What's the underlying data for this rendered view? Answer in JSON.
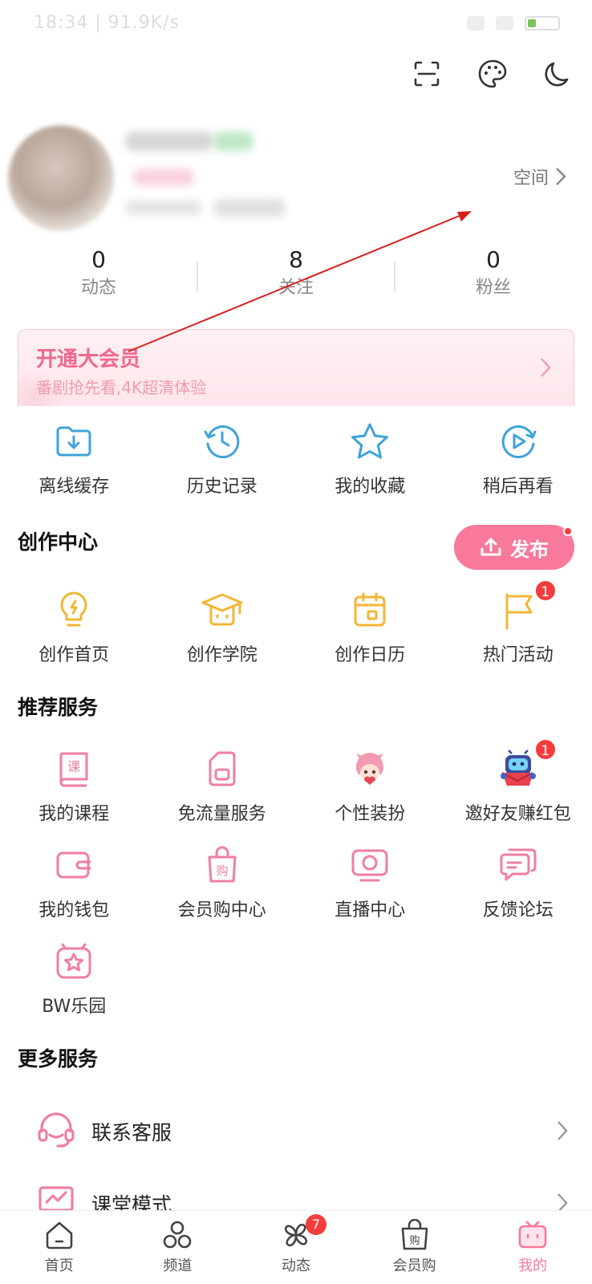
{
  "status_bar": {
    "text": "18:34 | 91.9K/s"
  },
  "header": {
    "icons": [
      "scan-icon",
      "palette-icon",
      "moon-icon"
    ],
    "space_link": "空间"
  },
  "stats": [
    {
      "value": "0",
      "label": "动态"
    },
    {
      "value": "8",
      "label": "关注"
    },
    {
      "value": "0",
      "label": "粉丝"
    }
  ],
  "vip": {
    "title": "开通大会员",
    "subtitle": "番剧抢先看,4K超清体验"
  },
  "quick_actions": [
    {
      "label": "离线缓存",
      "icon": "download-folder-icon"
    },
    {
      "label": "历史记录",
      "icon": "history-icon"
    },
    {
      "label": "我的收藏",
      "icon": "star-icon"
    },
    {
      "label": "稍后再看",
      "icon": "watch-later-icon"
    }
  ],
  "creation": {
    "title": "创作中心",
    "publish_label": "发布",
    "items": [
      {
        "label": "创作首页",
        "icon": "bulb-icon"
      },
      {
        "label": "创作学院",
        "icon": "graduation-cap-icon"
      },
      {
        "label": "创作日历",
        "icon": "calendar-icon"
      },
      {
        "label": "热门活动",
        "icon": "flag-icon",
        "badge": "1"
      }
    ]
  },
  "recommend": {
    "title": "推荐服务",
    "items": [
      {
        "label": "我的课程",
        "icon": "course-book-icon"
      },
      {
        "label": "免流量服务",
        "icon": "sim-card-icon"
      },
      {
        "label": "个性装扮",
        "icon": "avatar-costume-icon"
      },
      {
        "label": "邀好友赚红包",
        "icon": "red-envelope-robot-icon",
        "badge": "1"
      },
      {
        "label": "我的钱包",
        "icon": "wallet-icon"
      },
      {
        "label": "会员购中心",
        "icon": "shopping-bag-icon"
      },
      {
        "label": "直播中心",
        "icon": "live-tv-icon"
      },
      {
        "label": "反馈论坛",
        "icon": "feedback-chat-icon"
      },
      {
        "label": "BW乐园",
        "icon": "bw-star-icon"
      }
    ]
  },
  "more": {
    "title": "更多服务",
    "items": [
      {
        "label": "联系客服",
        "icon": "headset-icon"
      },
      {
        "label": "课堂模式",
        "icon": "classroom-icon"
      }
    ]
  },
  "tabs": [
    {
      "label": "首页",
      "icon": "home-icon"
    },
    {
      "label": "频道",
      "icon": "channel-icon"
    },
    {
      "label": "动态",
      "icon": "pinwheel-icon",
      "badge": "7"
    },
    {
      "label": "会员购",
      "icon": "shop-bag-icon"
    },
    {
      "label": "我的",
      "icon": "tv-mine-icon",
      "active": true
    }
  ],
  "colors": {
    "accent": "#f8799b",
    "blue_icon": "#3ea3d9",
    "yellow_icon": "#f2b635",
    "pink_icon": "#ee7fa2",
    "badge": "#f33d3d",
    "annotation_arrow": "#d62020"
  }
}
